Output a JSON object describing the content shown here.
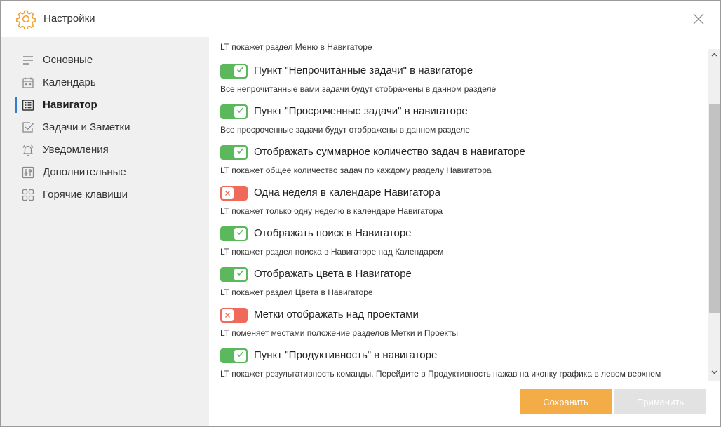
{
  "window": {
    "title": "Настройки"
  },
  "sidebar": {
    "items": [
      {
        "label": "Основные",
        "icon": "lines-icon",
        "active": false
      },
      {
        "label": "Календарь",
        "icon": "calendar-icon",
        "active": false
      },
      {
        "label": "Навигатор",
        "icon": "navigator-icon",
        "active": true
      },
      {
        "label": "Задачи и Заметки",
        "icon": "checkbox-icon",
        "active": false
      },
      {
        "label": "Уведомления",
        "icon": "bell-icon",
        "active": false
      },
      {
        "label": "Дополнительные",
        "icon": "sliders-icon",
        "active": false
      },
      {
        "label": "Горячие клавиши",
        "icon": "hotkeys-icon",
        "active": false
      }
    ]
  },
  "content": {
    "partial_text": "LT покажет раздел Меню в Навигаторе",
    "settings": [
      {
        "title": "Пункт \"Непрочитанные задачи\" в навигаторе",
        "description": "Все непрочитанные вами задачи будут отображены в данном разделе",
        "enabled": true
      },
      {
        "title": "Пункт \"Просроченные задачи\" в навигаторе",
        "description": "Все просроченные задачи будут отображены в данном разделе",
        "enabled": true
      },
      {
        "title": "Отображать суммарное количество задач в навигаторе",
        "description": "LT покажет общее количество задач по каждому разделу Навигатора",
        "enabled": true
      },
      {
        "title": "Одна неделя в календаре Навигатора",
        "description": "LT покажет только одну неделю в календаре Навигатора",
        "enabled": false
      },
      {
        "title": "Отображать поиск в Навигаторе",
        "description": "LT покажет раздел поиска в Навигаторе над Календарем",
        "enabled": true
      },
      {
        "title": "Отображать цвета в Навигаторе",
        "description": "LT покажет раздел Цвета в Навигаторе",
        "enabled": true
      },
      {
        "title": "Метки отображать над проектами",
        "description": "LT поменяет местами положение разделов Метки и Проекты",
        "enabled": false
      },
      {
        "title": "Пункт \"Продуктивность\" в навигаторе",
        "description": "LT покажет результативность команды. Перейдите в Продуктивность нажав на иконку графика в левом верхнем",
        "enabled": true
      }
    ]
  },
  "footer": {
    "save_label": "Сохранить",
    "apply_label": "Применить"
  },
  "colors": {
    "toggle_on": "#5cb85c",
    "toggle_off": "#ef6a5a",
    "save_button": "#f4ac46",
    "apply_button": "#e2e2e2",
    "active_indicator": "#2f7dd1",
    "gear": "#f0a030"
  }
}
